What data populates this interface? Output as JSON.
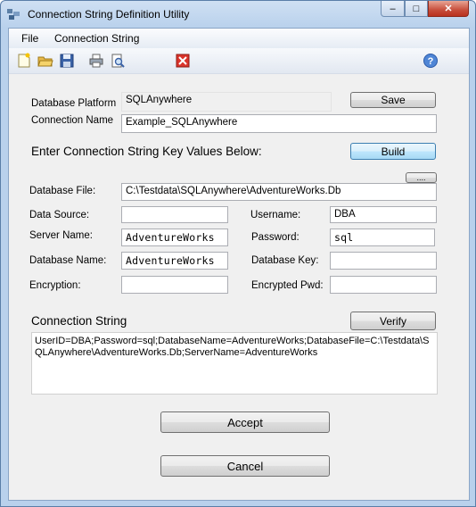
{
  "window": {
    "title": "Connection String Definition Utility",
    "close_glyph": "✕",
    "max_glyph": "□",
    "min_glyph": "–"
  },
  "menu": {
    "items": [
      "File",
      "Connection String"
    ]
  },
  "toolbar": {
    "icons": [
      "new-icon",
      "open-icon",
      "save-icon",
      "print-icon",
      "print-preview-icon",
      "exit-icon",
      "help-icon"
    ]
  },
  "form": {
    "database_platform_label": "Database Platform",
    "database_platform_value": "SQLAnywhere",
    "connection_name_label": "Connection Name",
    "connection_name_value": "Example_SQLAnywhere",
    "save_button": "Save",
    "enter_keys_heading": "Enter Connection String Key Values Below:",
    "build_button": "Build",
    "browse_button": "....",
    "database_file_label": "Database File:",
    "database_file_value": "C:\\Testdata\\SQLAnywhere\\AdventureWorks.Db",
    "data_source_label": "Data Source:",
    "data_source_value": "",
    "username_label": "Username:",
    "username_value": "DBA",
    "server_name_label": "Server Name:",
    "server_name_value": "AdventureWorks",
    "password_label": "Password:",
    "password_value": "sql",
    "database_name_label": "Database Name:",
    "database_name_value": "AdventureWorks",
    "database_key_label": "Database Key:",
    "database_key_value": "",
    "encryption_label": "Encryption:",
    "encryption_value": "",
    "encrypted_pwd_label": "Encrypted Pwd:",
    "encrypted_pwd_value": "",
    "connection_string_heading": "Connection String",
    "verify_button": "Verify",
    "connection_string_value": "UserID=DBA;Password=sql;DatabaseName=AdventureWorks;DatabaseFile=C:\\Testdata\\SQLAnywhere\\AdventureWorks.Db;ServerName=AdventureWorks",
    "accept_button": "Accept",
    "cancel_button": "Cancel"
  },
  "colors": {
    "window_frame": "#b9d1ec",
    "close_button": "#c74e3b",
    "focus_button": "#bee6fd"
  }
}
